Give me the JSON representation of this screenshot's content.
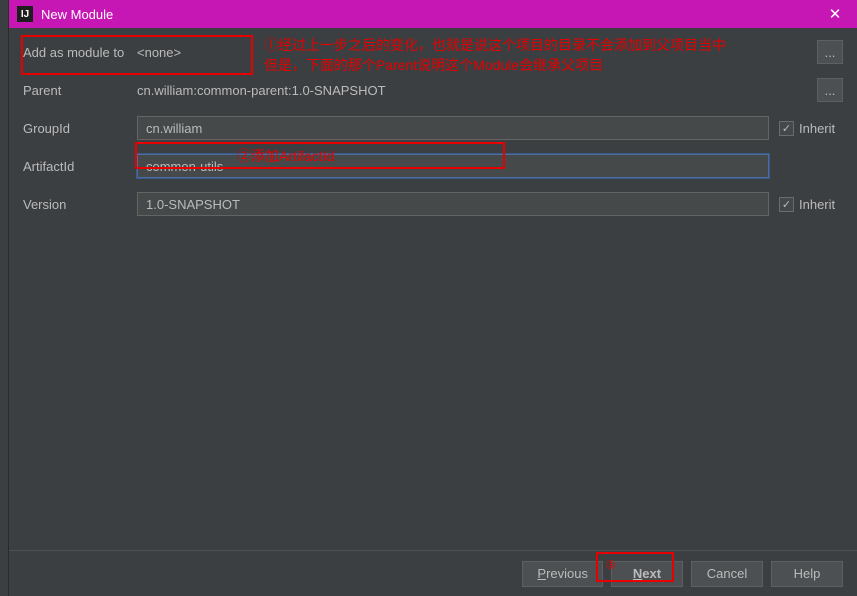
{
  "titlebar": {
    "title": "New Module",
    "close_glyph": "✕",
    "app_glyph": "IJ"
  },
  "rows": {
    "module_to_label": "Add as module to",
    "module_to_value": "<none>",
    "parent_label": "Parent",
    "parent_value": "cn.william:common-parent:1.0-SNAPSHOT",
    "groupid_label": "GroupId",
    "groupid_value": "cn.william",
    "artifactid_label": "ArtifactId",
    "artifactid_value": "common-utils",
    "version_label": "Version",
    "version_value": "1.0-SNAPSHOT",
    "inherit_label": "Inherit",
    "ellipsis": "..."
  },
  "footer": {
    "previous": "Previous",
    "next": "Next",
    "cancel": "Cancel",
    "help": "Help"
  },
  "annotations": {
    "a1": "①经过上一步之后的变化，也就是说这个项目的目录不会添加到父项目当中\n但是，下面的那个Parent说明这个Module会继承父项目",
    "a2": "②添加ArtifactId",
    "a3": "③"
  },
  "checkbox_check": "✓"
}
